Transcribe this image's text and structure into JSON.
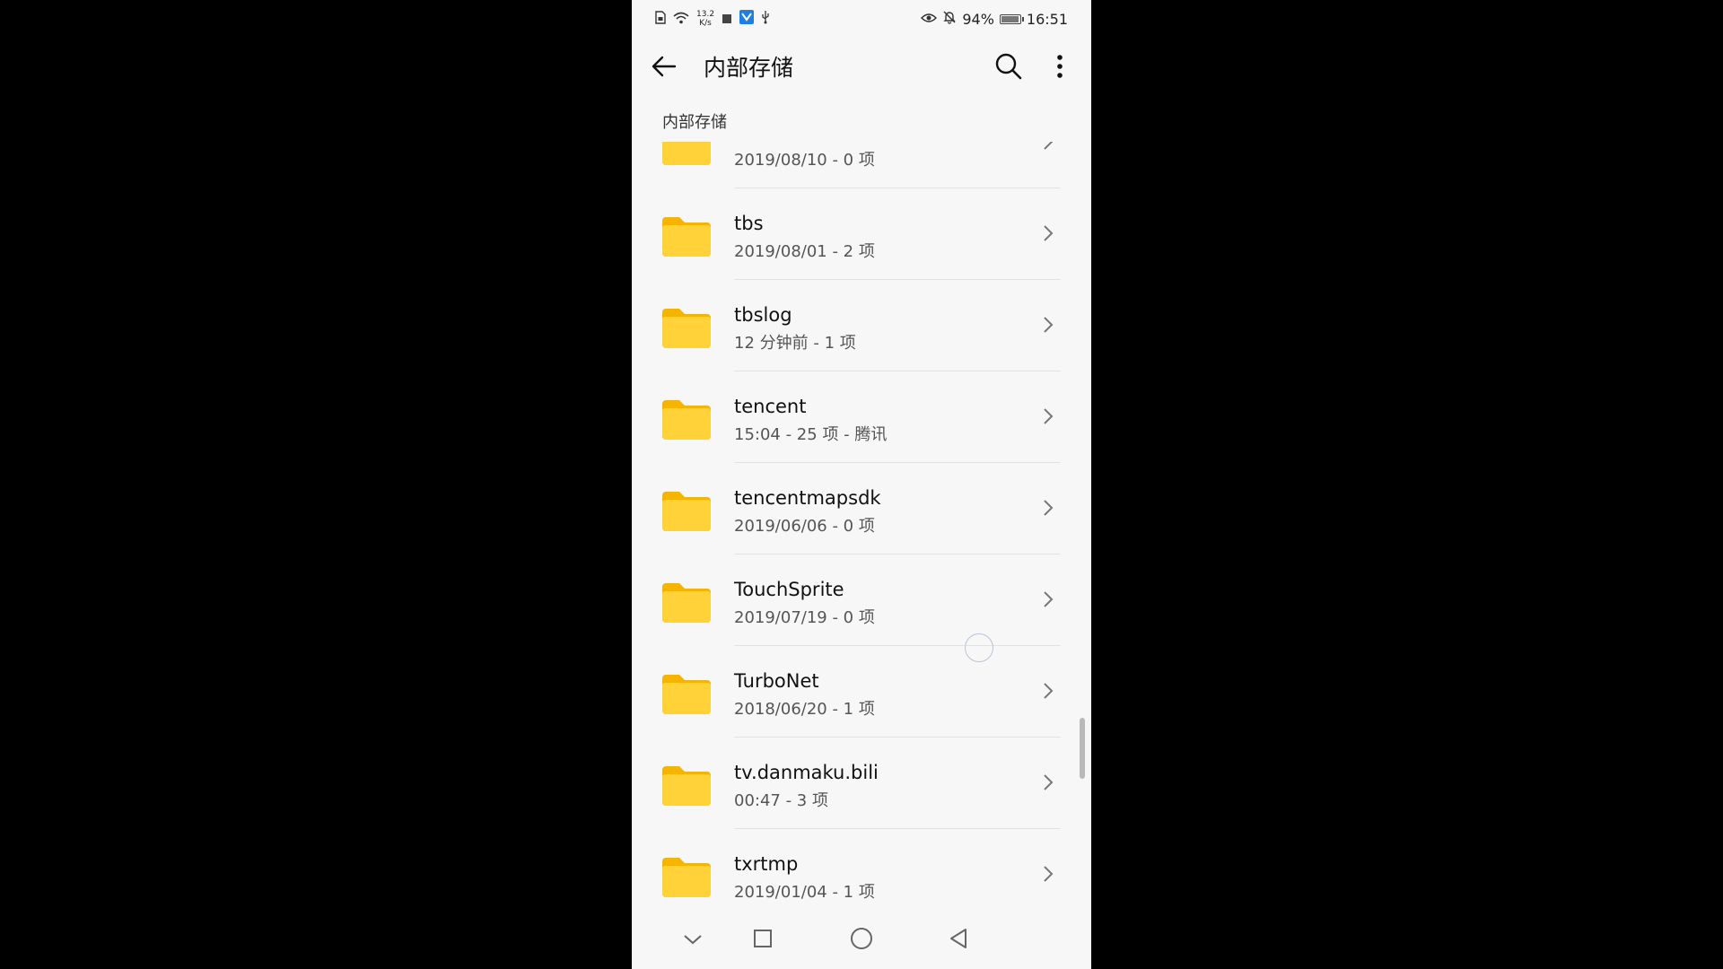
{
  "status_bar": {
    "net_speed_value": "13.2",
    "net_speed_unit": "K/s",
    "battery_percent": "94%",
    "battery_level": 0.94,
    "time": "16:51"
  },
  "app_bar": {
    "title": "内部存储"
  },
  "breadcrumb": "内部存储",
  "folders": [
    {
      "name": "",
      "meta": "2019/08/10 - 0 项"
    },
    {
      "name": "tbs",
      "meta": "2019/08/01 - 2 项"
    },
    {
      "name": "tbslog",
      "meta": "12 分钟前 - 1 项"
    },
    {
      "name": "tencent",
      "meta": "15:04 - 25 项 - 腾讯"
    },
    {
      "name": "tencentmapsdk",
      "meta": "2019/06/06 - 0 项"
    },
    {
      "name": "TouchSprite",
      "meta": "2019/07/19 - 0 项"
    },
    {
      "name": "TurboNet",
      "meta": "2018/06/20 - 1 项"
    },
    {
      "name": "tv.danmaku.bili",
      "meta": "00:47 - 3 项"
    },
    {
      "name": "txrtmp",
      "meta": "2019/01/04 - 1 项"
    }
  ],
  "colors": {
    "folder": "#FFC61A",
    "folder_tab": "#F5B400",
    "folder_front": "#FFD23A"
  },
  "icons": {
    "back": "arrow-left-icon",
    "search": "search-icon",
    "more": "more-vertical-icon",
    "folder": "folder-icon",
    "chevron": "chevron-right-icon",
    "nav_down": "chevron-down-icon",
    "nav_recents": "square-icon",
    "nav_home": "circle-icon",
    "nav_back": "triangle-back-icon"
  }
}
